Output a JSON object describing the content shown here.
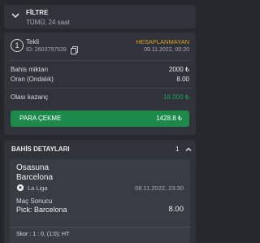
{
  "filter": {
    "title": "FİLTRE",
    "subtitle": "TÜMÜ, 24 saat"
  },
  "bet": {
    "number": "1",
    "type": "Tekli",
    "id": "ID: 2603757539",
    "status": "HESAPLANMAYAN",
    "status_color": "#d9a21a",
    "date": "09.11.2022, 00:20",
    "stake_label": "Bahis miktarı",
    "stake_value": "2000 ₺",
    "odds_label": "Oran (Ondalık)",
    "odds_value": "8.00",
    "win_label": "Olası kazanç",
    "win_value": "16.000 ₺",
    "cashout_label": "PARA ÇEKME",
    "cashout_value": "1428.8 ₺",
    "cashout_color": "#1b8a4b"
  },
  "details": {
    "title": "BAHİS DETAYLARI",
    "count": "1",
    "match": {
      "team_home": "Osasuna",
      "team_away": "Barcelona",
      "league": "La Liga",
      "league_icon": "soccer-ball-icon",
      "date": "08.11.2022, 23:30",
      "market": "Maç Sonucu",
      "pick": "Pick: Barcelona",
      "odd": "8.00",
      "score": "Skor : 1 : 0, (1:0); HT"
    }
  }
}
